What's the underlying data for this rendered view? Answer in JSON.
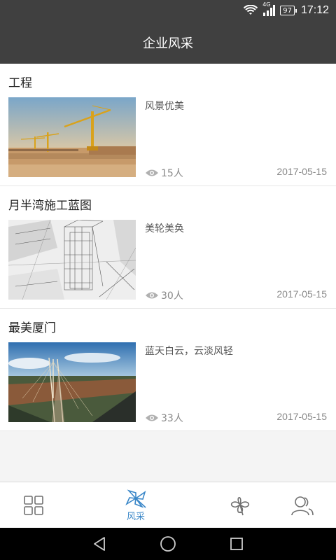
{
  "status_bar": {
    "network": "4G",
    "battery": "97",
    "time": "17:12"
  },
  "header": {
    "title": "企业风采"
  },
  "items": [
    {
      "title": "工程",
      "description": "风景优美",
      "views": "15人",
      "date": "2017-05-15",
      "image": "construction-cranes"
    },
    {
      "title": "月半湾施工蓝图",
      "description": "美轮美奂",
      "views": "30人",
      "date": "2017-05-15",
      "image": "blueprint-sketch"
    },
    {
      "title": "最美厦门",
      "description": "蓝天白云，云淡风轻",
      "views": "33人",
      "date": "2017-05-15",
      "image": "bridge-aerial"
    }
  ],
  "tabs": [
    {
      "icon": "grid-icon"
    },
    {
      "icon": "pinwheel-icon",
      "label": "风采",
      "active": true
    },
    {
      "icon": "clover-icon"
    },
    {
      "icon": "users-icon"
    }
  ],
  "colors": {
    "header_bg": "#404040",
    "accent": "#3a87c8"
  }
}
